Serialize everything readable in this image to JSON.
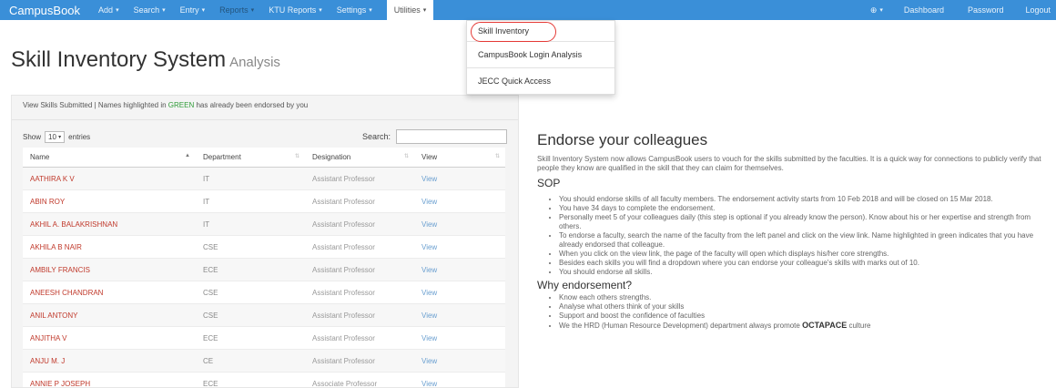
{
  "navbar": {
    "brand": "CampusBook",
    "items": [
      {
        "label": "Add"
      },
      {
        "label": "Search"
      },
      {
        "label": "Entry"
      },
      {
        "label": "Reports"
      },
      {
        "label": "KTU Reports"
      },
      {
        "label": "Settings"
      },
      {
        "label": "Utilities"
      }
    ],
    "right": {
      "help_label": "",
      "dashboard": "Dashboard",
      "password": "Password",
      "logout": "Logout"
    },
    "bg_color": "#3a8fd8"
  },
  "dropdown": {
    "items": [
      "Skill Inventory",
      "CampusBook Login Analysis",
      "JECC Quick Access"
    ]
  },
  "page": {
    "title": "Skill Inventory System",
    "subtitle": "Analysis"
  },
  "left_panel": {
    "heading_pre": "View Skills Submitted | Names highlighted in ",
    "heading_green": "GREEN",
    "heading_post": " has already been endorsed by you",
    "show_label": "Show",
    "show_value": "10",
    "entries_label": "entries",
    "search_label": "Search:",
    "search_value": "",
    "columns": [
      "Name",
      "Department",
      "Designation",
      "View"
    ],
    "rows": [
      {
        "name": "AATHIRA K V",
        "dept": "IT",
        "desig": "Assistant Professor",
        "view": "View"
      },
      {
        "name": "ABIN ROY",
        "dept": "IT",
        "desig": "Assistant Professor",
        "view": "View"
      },
      {
        "name": "AKHIL A. BALAKRISHNAN",
        "dept": "IT",
        "desig": "Assistant Professor",
        "view": "View"
      },
      {
        "name": "AKHILA B NAIR",
        "dept": "CSE",
        "desig": "Assistant Professor",
        "view": "View"
      },
      {
        "name": "AMBILY FRANCIS",
        "dept": "ECE",
        "desig": "Assistant Professor",
        "view": "View"
      },
      {
        "name": "ANEESH CHANDRAN",
        "dept": "CSE",
        "desig": "Assistant Professor",
        "view": "View"
      },
      {
        "name": "ANIL ANTONY",
        "dept": "CSE",
        "desig": "Assistant Professor",
        "view": "View"
      },
      {
        "name": "ANJITHA V",
        "dept": "ECE",
        "desig": "Assistant Professor",
        "view": "View"
      },
      {
        "name": "ANJU M. J",
        "dept": "CE",
        "desig": "Assistant Professor",
        "view": "View"
      },
      {
        "name": "ANNIE P JOSEPH",
        "dept": "ECE",
        "desig": "Associate Professor",
        "view": "View"
      }
    ]
  },
  "right_panel": {
    "heading": "Endorse your colleagues",
    "intro": "Skill Inventory System now allows CampusBook users to vouch for the skills submitted by the faculties. It is a quick way for connections to publicly verify that people they know are qualified in the skill that they can claim for themselves.",
    "sop_heading": "SOP",
    "sop_items": [
      "You should endorse skills of all faculty members. The endorsement activity starts from 10 Feb 2018 and will be closed on 15 Mar 2018.",
      "You have 34 days to complete the endorsement.",
      "Personally meet 5 of your colleagues daily (this step is optional if you already know the person). Know about his or her expertise and strength from others.",
      "To endorse a faculty, search the name of the faculty from the left panel and click on the view link. Name highlighted in green indicates that you have already endorsed that colleague.",
      "When you click on the view link, the page of the faculty will open which displays his/her core strengths.",
      "Besides each skills you will find a dropdown where you can endorse your colleague's skills with marks out of 10.",
      "You should endorse all skills."
    ],
    "why_heading": "Why endorsement?",
    "why_items": [
      "Know each others strengths.",
      "Analyse what others think of your skills",
      "Support and boost the confidence of faculties"
    ],
    "why_last_pre": "We the HRD (Human Resource Development) department always promote ",
    "why_last_bold": "OCTAPACE",
    "why_last_post": " culture"
  }
}
